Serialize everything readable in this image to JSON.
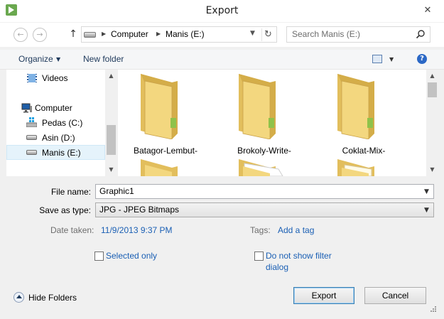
{
  "window": {
    "title": "Export",
    "close_symbol": "✕"
  },
  "nav": {
    "back_symbol": "←",
    "forward_symbol": "→",
    "up_symbol": "↑",
    "breadcrumbs": [
      "Computer",
      "Manis (E:)"
    ],
    "search_placeholder": "Search Manis (E:)"
  },
  "toolbar": {
    "organize_label": "Organize",
    "new_folder_label": "New folder",
    "help_symbol": "?"
  },
  "sidebar": {
    "items": [
      {
        "label": "Videos",
        "icon": "videos-icon"
      },
      {
        "label": "Computer",
        "icon": "computer-icon"
      },
      {
        "label": "Pedas (C:)",
        "icon": "windows-drive-icon"
      },
      {
        "label": "Asin (D:)",
        "icon": "drive-icon"
      },
      {
        "label": "Manis (E:)",
        "icon": "drive-icon",
        "selected": true
      }
    ]
  },
  "files": {
    "folders": [
      {
        "label": "Batagor-Lembut-",
        "icon": "folder-icon"
      },
      {
        "label": "Brokoly-Write-",
        "icon": "folder-icon"
      },
      {
        "label": "Coklat-Mix-",
        "icon": "folder-icon"
      }
    ]
  },
  "form": {
    "file_name_label": "File name:",
    "file_name_value": "Graphic1",
    "save_type_label": "Save as type:",
    "save_type_value": "JPG - JPEG Bitmaps",
    "date_taken_label": "Date taken:",
    "date_taken_value": "11/9/2013 9:37 PM",
    "tags_label": "Tags:",
    "tags_value": "Add a tag",
    "selected_only_label": "Selected only",
    "no_filter_line1": "Do not show filter",
    "no_filter_line2": "dialog"
  },
  "footer": {
    "hide_folders_label": "Hide Folders",
    "export_label": "Export",
    "cancel_label": "Cancel"
  },
  "colors": {
    "accent": "#1a5fb4",
    "selection": "#e5f3fb",
    "folder": "#f3d77f"
  }
}
